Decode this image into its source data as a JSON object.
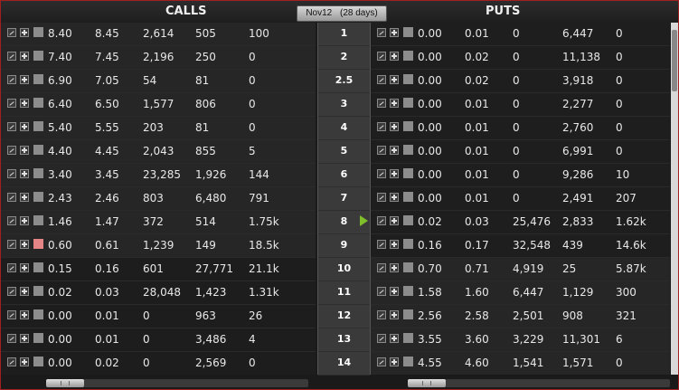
{
  "header": {
    "calls_title": "CALLS",
    "puts_title": "PUTS",
    "expiry": "Nov12",
    "days": "(28 days)"
  },
  "strikes": [
    "1",
    "2",
    "2.5",
    "3",
    "4",
    "5",
    "6",
    "7",
    "8",
    "9",
    "10",
    "11",
    "12",
    "13",
    "14"
  ],
  "current_strike_indicator": "8",
  "calls": [
    [
      "8.40",
      "8.45",
      "2,614",
      "505",
      "100"
    ],
    [
      "7.40",
      "7.45",
      "2,196",
      "250",
      "0"
    ],
    [
      "6.90",
      "7.05",
      "54",
      "81",
      "0"
    ],
    [
      "6.40",
      "6.50",
      "1,577",
      "806",
      "0"
    ],
    [
      "5.40",
      "5.55",
      "203",
      "81",
      "0"
    ],
    [
      "4.40",
      "4.45",
      "2,043",
      "855",
      "5"
    ],
    [
      "3.40",
      "3.45",
      "23,285",
      "1,926",
      "144"
    ],
    [
      "2.43",
      "2.46",
      "803",
      "6,480",
      "791"
    ],
    [
      "1.46",
      "1.47",
      "372",
      "514",
      "1.75k"
    ],
    [
      "0.60",
      "0.61",
      "1,239",
      "149",
      "18.5k"
    ],
    [
      "0.15",
      "0.16",
      "601",
      "27,771",
      "21.1k"
    ],
    [
      "0.02",
      "0.03",
      "28,048",
      "1,423",
      "1.31k"
    ],
    [
      "0.00",
      "0.01",
      "0",
      "963",
      "26"
    ],
    [
      "0.00",
      "0.01",
      "0",
      "3,486",
      "4"
    ],
    [
      "0.00",
      "0.02",
      "0",
      "2,569",
      "0"
    ]
  ],
  "puts": [
    [
      "0.00",
      "0.01",
      "0",
      "6,447",
      "0"
    ],
    [
      "0.00",
      "0.02",
      "0",
      "11,138",
      "0"
    ],
    [
      "0.00",
      "0.02",
      "0",
      "3,918",
      "0"
    ],
    [
      "0.00",
      "0.01",
      "0",
      "2,277",
      "0"
    ],
    [
      "0.00",
      "0.01",
      "0",
      "2,760",
      "0"
    ],
    [
      "0.00",
      "0.01",
      "0",
      "6,991",
      "0"
    ],
    [
      "0.00",
      "0.01",
      "0",
      "9,286",
      "10"
    ],
    [
      "0.00",
      "0.01",
      "0",
      "2,491",
      "207"
    ],
    [
      "0.02",
      "0.03",
      "25,476",
      "2,833",
      "1.62k"
    ],
    [
      "0.16",
      "0.17",
      "32,548",
      "439",
      "14.6k"
    ],
    [
      "0.70",
      "0.71",
      "4,919",
      "25",
      "5.87k"
    ],
    [
      "1.58",
      "1.60",
      "6,447",
      "1,129",
      "300"
    ],
    [
      "2.56",
      "2.58",
      "2,501",
      "908",
      "321"
    ],
    [
      "3.55",
      "3.60",
      "3,229",
      "11,301",
      "6"
    ],
    [
      "4.55",
      "4.60",
      "1,541",
      "1,571",
      "0"
    ]
  ],
  "highlighted_call_row": 9,
  "colors": {
    "frame_border": "#a02020",
    "atm_arrow": "#7fbf2a",
    "highlight_swatch": "#e58585"
  },
  "icons": {
    "row_chart": "chart-icon",
    "row_add": "plus-icon",
    "row_status": "color-swatch"
  }
}
